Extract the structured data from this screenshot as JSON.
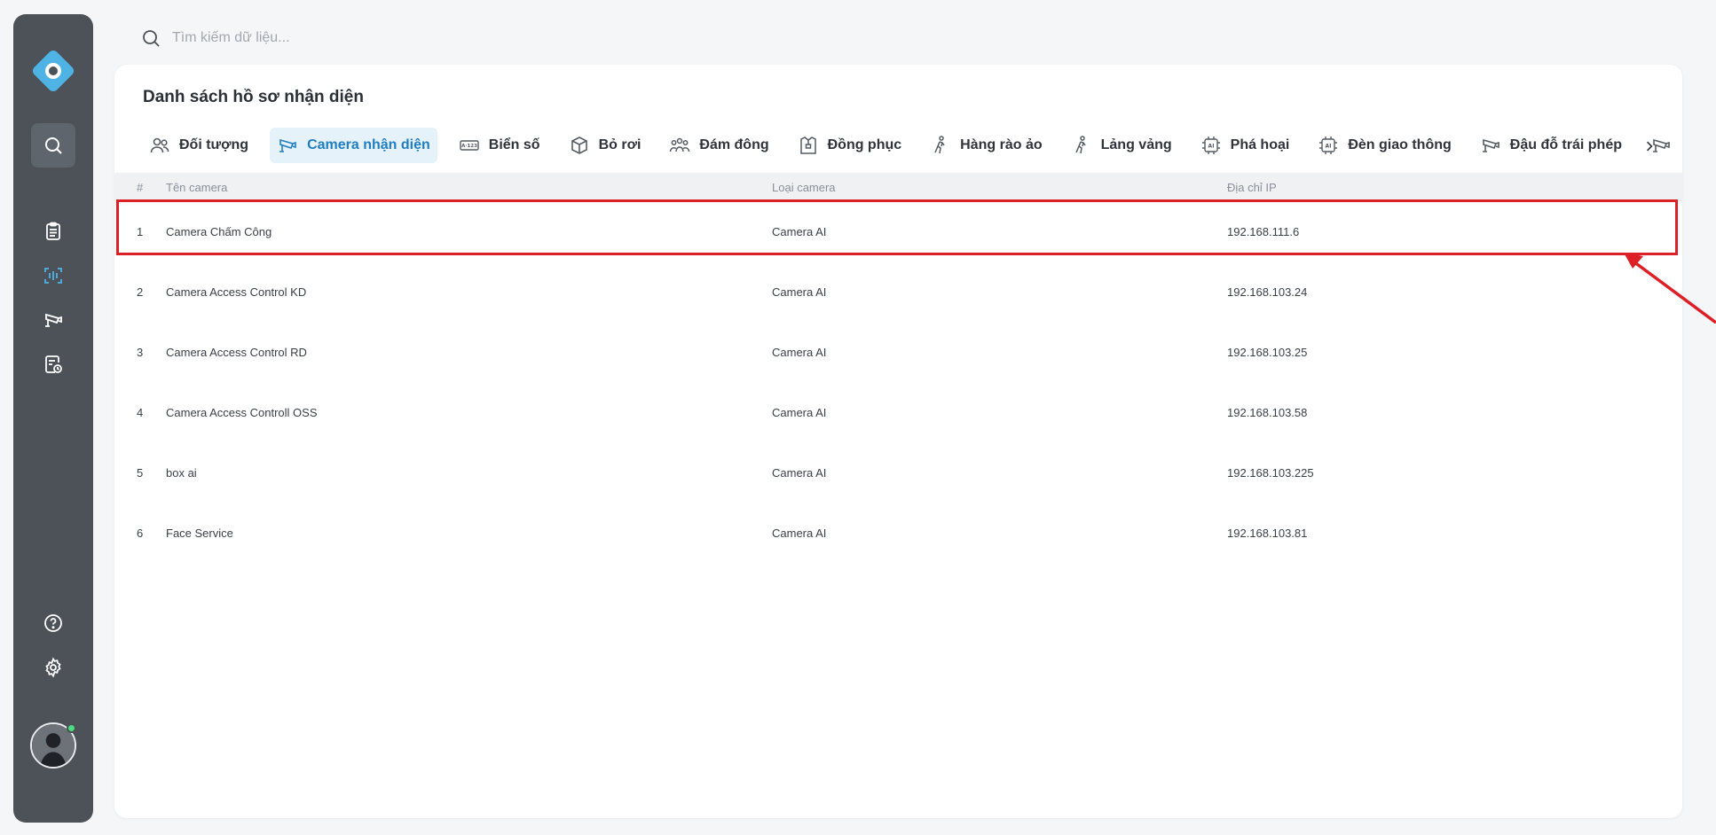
{
  "search": {
    "placeholder": "Tìm kiếm dữ liệu..."
  },
  "sidebar": {
    "items": [
      {
        "name": "search",
        "icon": "search-icon",
        "active": true
      },
      {
        "name": "list",
        "icon": "clipboard-list-icon"
      },
      {
        "name": "face-scan",
        "icon": "face-scan-icon"
      },
      {
        "name": "camera",
        "icon": "cctv-camera-icon"
      },
      {
        "name": "report",
        "icon": "report-clock-icon"
      },
      {
        "name": "help",
        "icon": "help-circle-icon"
      },
      {
        "name": "settings",
        "icon": "gear-icon"
      }
    ],
    "accent": "#4fb3e6"
  },
  "main": {
    "title": "Danh sách hồ sơ nhận diện",
    "tabs": [
      {
        "label": "Đối tượng",
        "icon": "people-icon"
      },
      {
        "label": "Camera nhận diện",
        "icon": "cctv-camera-icon",
        "active": true
      },
      {
        "label": "Biển số",
        "icon": "license-plate-icon"
      },
      {
        "label": "Bỏ rơi",
        "icon": "box-icon"
      },
      {
        "label": "Đám đông",
        "icon": "crowd-icon"
      },
      {
        "label": "Đồng phục",
        "icon": "uniform-icon"
      },
      {
        "label": "Hàng rào ảo",
        "icon": "walking-person-icon"
      },
      {
        "label": "Lảng vảng",
        "icon": "walking-person-icon"
      },
      {
        "label": "Phá hoại",
        "icon": "ai-chip-icon"
      },
      {
        "label": "Đèn giao thông",
        "icon": "ai-chip-icon"
      },
      {
        "label": "Đậu đỗ trái phép",
        "icon": "cctv-camera-icon"
      }
    ],
    "table": {
      "columns": [
        "#",
        "Tên camera",
        "Loại camera",
        "Địa chỉ IP"
      ],
      "rows": [
        {
          "index": "1",
          "name": "Camera Chấm Công",
          "type": "Camera AI",
          "ip": "192.168.111.6"
        },
        {
          "index": "2",
          "name": "Camera Access Control KD",
          "type": "Camera AI",
          "ip": "192.168.103.24"
        },
        {
          "index": "3",
          "name": "Camera Access Control RD",
          "type": "Camera AI",
          "ip": "192.168.103.25"
        },
        {
          "index": "4",
          "name": "Camera Access Controll OSS",
          "type": "Camera AI",
          "ip": "192.168.103.58"
        },
        {
          "index": "5",
          "name": "box ai",
          "type": "Camera AI",
          "ip": "192.168.103.225"
        },
        {
          "index": "6",
          "name": "Face Service",
          "type": "Camera AI",
          "ip": "192.168.103.81"
        }
      ]
    },
    "active_tab_color": "#1f7ec0",
    "highlight_color": "#dd1f26"
  }
}
